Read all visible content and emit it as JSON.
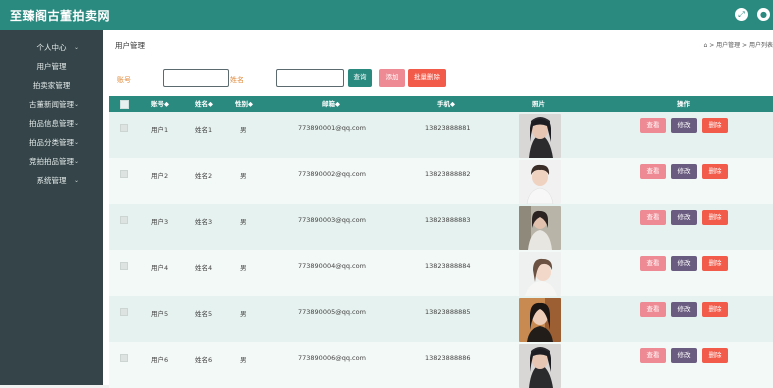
{
  "app": {
    "title": "至臻阁古董拍卖网"
  },
  "sidebar": {
    "items": [
      {
        "label": "个人中心",
        "chevron": true
      },
      {
        "label": "用户管理",
        "chevron": false
      },
      {
        "label": "拍卖家管理",
        "chevron": false
      },
      {
        "label": "古董新闻管理",
        "chevron": true
      },
      {
        "label": "拍品信息管理",
        "chevron": true
      },
      {
        "label": "拍品分类管理",
        "chevron": true
      },
      {
        "label": "竞拍拍品管理",
        "chevron": true
      },
      {
        "label": "系统管理",
        "chevron": true
      }
    ]
  },
  "page": {
    "title": "用户管理",
    "breadcrumb": "⌂ > 用户管理 > 用户列表"
  },
  "search": {
    "account_label": "账号",
    "name_label": "姓名",
    "account_value": "",
    "name_value": "",
    "search_btn": "查询",
    "add_btn": "添加",
    "batch_delete_btn": "批量删除"
  },
  "table": {
    "headers": [
      "账号◆",
      "姓名◆",
      "性别◆",
      "邮箱◆",
      "手机◆",
      "照片",
      "操作"
    ],
    "actions": {
      "view": "查看",
      "edit": "修改",
      "delete": "删除"
    },
    "rows": [
      {
        "account": "用户1",
        "name": "姓名1",
        "gender": "男",
        "email": "773890001@qq.com",
        "phone": "13823888881"
      },
      {
        "account": "用户2",
        "name": "姓名2",
        "gender": "男",
        "email": "773890002@qq.com",
        "phone": "13823888882"
      },
      {
        "account": "用户3",
        "name": "姓名3",
        "gender": "男",
        "email": "773890003@qq.com",
        "phone": "13823888883"
      },
      {
        "account": "用户4",
        "name": "姓名4",
        "gender": "男",
        "email": "773890004@qq.com",
        "phone": "13823888884"
      },
      {
        "account": "用户5",
        "name": "姓名5",
        "gender": "男",
        "email": "773890005@qq.com",
        "phone": "13823888885"
      },
      {
        "account": "用户6",
        "name": "姓名6",
        "gender": "男",
        "email": "773890006@qq.com",
        "phone": "13823888886"
      }
    ]
  },
  "colors": {
    "header": "#2a8a7f",
    "sidebar": "#344448",
    "search_btn": "#2a8a7f",
    "add_btn": "#ee8a93",
    "batch_delete_btn": "#f25a4a",
    "view_btn": "#ee8a93",
    "edit_btn": "#6a5c80",
    "delete_btn": "#f25a4a"
  },
  "icons": {
    "top_right_1": "fullscreen-icon",
    "top_right_2": "user-icon"
  }
}
